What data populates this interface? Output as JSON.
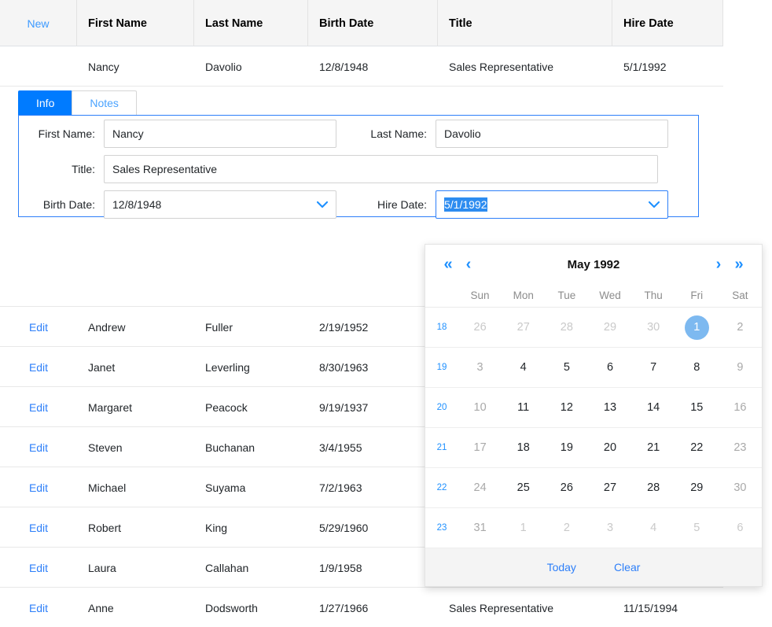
{
  "grid": {
    "columns": [
      {
        "key": "command",
        "label": ""
      },
      {
        "key": "firstName",
        "label": "First Name"
      },
      {
        "key": "lastName",
        "label": "Last Name"
      },
      {
        "key": "birthDate",
        "label": "Birth Date"
      },
      {
        "key": "title",
        "label": "Title"
      },
      {
        "key": "hireDate",
        "label": "Hire Date"
      }
    ],
    "new_label": "New",
    "edit_label": "Edit",
    "rows": [
      {
        "command": "",
        "firstName": "Nancy",
        "lastName": "Davolio",
        "birthDate": "12/8/1948",
        "title": "Sales Representative",
        "hireDate": "5/1/1992",
        "editing": true
      },
      {
        "command": "Edit",
        "firstName": "Andrew",
        "lastName": "Fuller",
        "birthDate": "2/19/1952",
        "title": "",
        "hireDate": "",
        "editing": false
      },
      {
        "command": "Edit",
        "firstName": "Janet",
        "lastName": "Leverling",
        "birthDate": "8/30/1963",
        "title": "",
        "hireDate": "",
        "editing": false
      },
      {
        "command": "Edit",
        "firstName": "Margaret",
        "lastName": "Peacock",
        "birthDate": "9/19/1937",
        "title": "",
        "hireDate": "",
        "editing": false
      },
      {
        "command": "Edit",
        "firstName": "Steven",
        "lastName": "Buchanan",
        "birthDate": "3/4/1955",
        "title": "",
        "hireDate": "",
        "editing": false
      },
      {
        "command": "Edit",
        "firstName": "Michael",
        "lastName": "Suyama",
        "birthDate": "7/2/1963",
        "title": "",
        "hireDate": "",
        "editing": false
      },
      {
        "command": "Edit",
        "firstName": "Robert",
        "lastName": "King",
        "birthDate": "5/29/1960",
        "title": "",
        "hireDate": "",
        "editing": false
      },
      {
        "command": "Edit",
        "firstName": "Laura",
        "lastName": "Callahan",
        "birthDate": "1/9/1958",
        "title": "",
        "hireDate": "",
        "editing": false
      },
      {
        "command": "Edit",
        "firstName": "Anne",
        "lastName": "Dodsworth",
        "birthDate": "1/27/1966",
        "title": "Sales Representative",
        "hireDate": "11/15/1994",
        "editing": false
      }
    ]
  },
  "edit_form": {
    "tabs": [
      {
        "label": "Info",
        "active": true
      },
      {
        "label": "Notes",
        "active": false
      }
    ],
    "fields": {
      "first_name_label": "First Name:",
      "first_name_value": "Nancy",
      "last_name_label": "Last Name:",
      "last_name_value": "Davolio",
      "title_label": "Title:",
      "title_value": "Sales Representative",
      "birth_date_label": "Birth Date:",
      "birth_date_value": "12/8/1948",
      "hire_date_label": "Hire Date:",
      "hire_date_value": "5/1/1992"
    }
  },
  "calendar": {
    "title": "May 1992",
    "nav": {
      "prev_year": "«",
      "prev_month": "‹",
      "next_month": "›",
      "next_year": "»"
    },
    "weekday_headers": [
      "Sun",
      "Mon",
      "Tue",
      "Wed",
      "Thu",
      "Fri",
      "Sat"
    ],
    "weeks": [
      {
        "number": "18",
        "days": [
          {
            "label": "26",
            "state": "muted"
          },
          {
            "label": "27",
            "state": "muted"
          },
          {
            "label": "28",
            "state": "muted"
          },
          {
            "label": "29",
            "state": "muted"
          },
          {
            "label": "30",
            "state": "muted"
          },
          {
            "label": "1",
            "state": "selected"
          },
          {
            "label": "2",
            "state": "weekend"
          }
        ]
      },
      {
        "number": "19",
        "days": [
          {
            "label": "3",
            "state": "weekend"
          },
          {
            "label": "4",
            "state": "normal"
          },
          {
            "label": "5",
            "state": "normal"
          },
          {
            "label": "6",
            "state": "normal"
          },
          {
            "label": "7",
            "state": "normal"
          },
          {
            "label": "8",
            "state": "normal"
          },
          {
            "label": "9",
            "state": "weekend"
          }
        ]
      },
      {
        "number": "20",
        "days": [
          {
            "label": "10",
            "state": "weekend"
          },
          {
            "label": "11",
            "state": "normal"
          },
          {
            "label": "12",
            "state": "normal"
          },
          {
            "label": "13",
            "state": "normal"
          },
          {
            "label": "14",
            "state": "normal"
          },
          {
            "label": "15",
            "state": "normal"
          },
          {
            "label": "16",
            "state": "weekend"
          }
        ]
      },
      {
        "number": "21",
        "days": [
          {
            "label": "17",
            "state": "weekend"
          },
          {
            "label": "18",
            "state": "normal"
          },
          {
            "label": "19",
            "state": "normal"
          },
          {
            "label": "20",
            "state": "normal"
          },
          {
            "label": "21",
            "state": "normal"
          },
          {
            "label": "22",
            "state": "normal"
          },
          {
            "label": "23",
            "state": "weekend"
          }
        ]
      },
      {
        "number": "22",
        "days": [
          {
            "label": "24",
            "state": "weekend"
          },
          {
            "label": "25",
            "state": "normal"
          },
          {
            "label": "26",
            "state": "normal"
          },
          {
            "label": "27",
            "state": "normal"
          },
          {
            "label": "28",
            "state": "normal"
          },
          {
            "label": "29",
            "state": "normal"
          },
          {
            "label": "30",
            "state": "weekend"
          }
        ]
      },
      {
        "number": "23",
        "days": [
          {
            "label": "31",
            "state": "weekend"
          },
          {
            "label": "1",
            "state": "muted"
          },
          {
            "label": "2",
            "state": "muted"
          },
          {
            "label": "3",
            "state": "muted"
          },
          {
            "label": "4",
            "state": "muted"
          },
          {
            "label": "5",
            "state": "muted"
          },
          {
            "label": "6",
            "state": "muted"
          }
        ]
      }
    ],
    "footer": {
      "today_label": "Today",
      "clear_label": "Clear"
    }
  },
  "colors": {
    "accent": "#007bff",
    "link": "#2d7ff9",
    "selection": "#2d8cf0",
    "selected_day": "#7db9f0",
    "header_bg": "#f5f5f5"
  }
}
